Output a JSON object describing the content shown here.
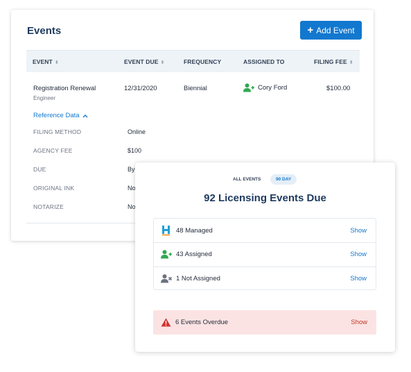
{
  "events": {
    "title": "Events",
    "add_button_label": "Add Event",
    "columns": [
      {
        "label": "EVENT",
        "sortable": true
      },
      {
        "label": "EVENT DUE",
        "sortable": true
      },
      {
        "label": "FREQUENCY",
        "sortable": false
      },
      {
        "label": "ASSIGNED TO",
        "sortable": false
      },
      {
        "label": "FILING FEE",
        "sortable": true
      }
    ],
    "row": {
      "event_name": "Registration Renewal",
      "event_sub": "Engineer",
      "event_due": "12/31/2020",
      "frequency": "Biennial",
      "assigned_to": "Cory Ford",
      "filing_fee": "$100.00"
    },
    "reference_toggle": "Reference Data",
    "reference": [
      {
        "label": "FILING METHOD",
        "value": "Online"
      },
      {
        "label": "AGENCY FEE",
        "value": "$100"
      },
      {
        "label": "DUE",
        "value": "By"
      },
      {
        "label": "ORIGINAL INK",
        "value": "No"
      },
      {
        "label": "NOTARIZE",
        "value": "No"
      }
    ]
  },
  "licensing": {
    "tabs": {
      "all": "ALL EVENTS",
      "ninety": "90 DAY"
    },
    "title": "92 Licensing Events Due",
    "rows": [
      {
        "label": "48 Managed",
        "action": "Show",
        "icon": "h-logo-icon"
      },
      {
        "label": "43 Assigned",
        "action": "Show",
        "icon": "user-plus-icon"
      },
      {
        "label": "1 Not Assigned",
        "action": "Show",
        "icon": "user-x-icon"
      }
    ],
    "overdue": {
      "label": "6 Events Overdue",
      "action": "Show",
      "icon": "warning-icon"
    }
  },
  "colors": {
    "accent": "#1278cf",
    "title": "#1e3a5f",
    "green": "#2fa84f",
    "gray_icon": "#6b7280",
    "danger": "#d32f2f",
    "overdue_bg": "#fbe3e3"
  }
}
